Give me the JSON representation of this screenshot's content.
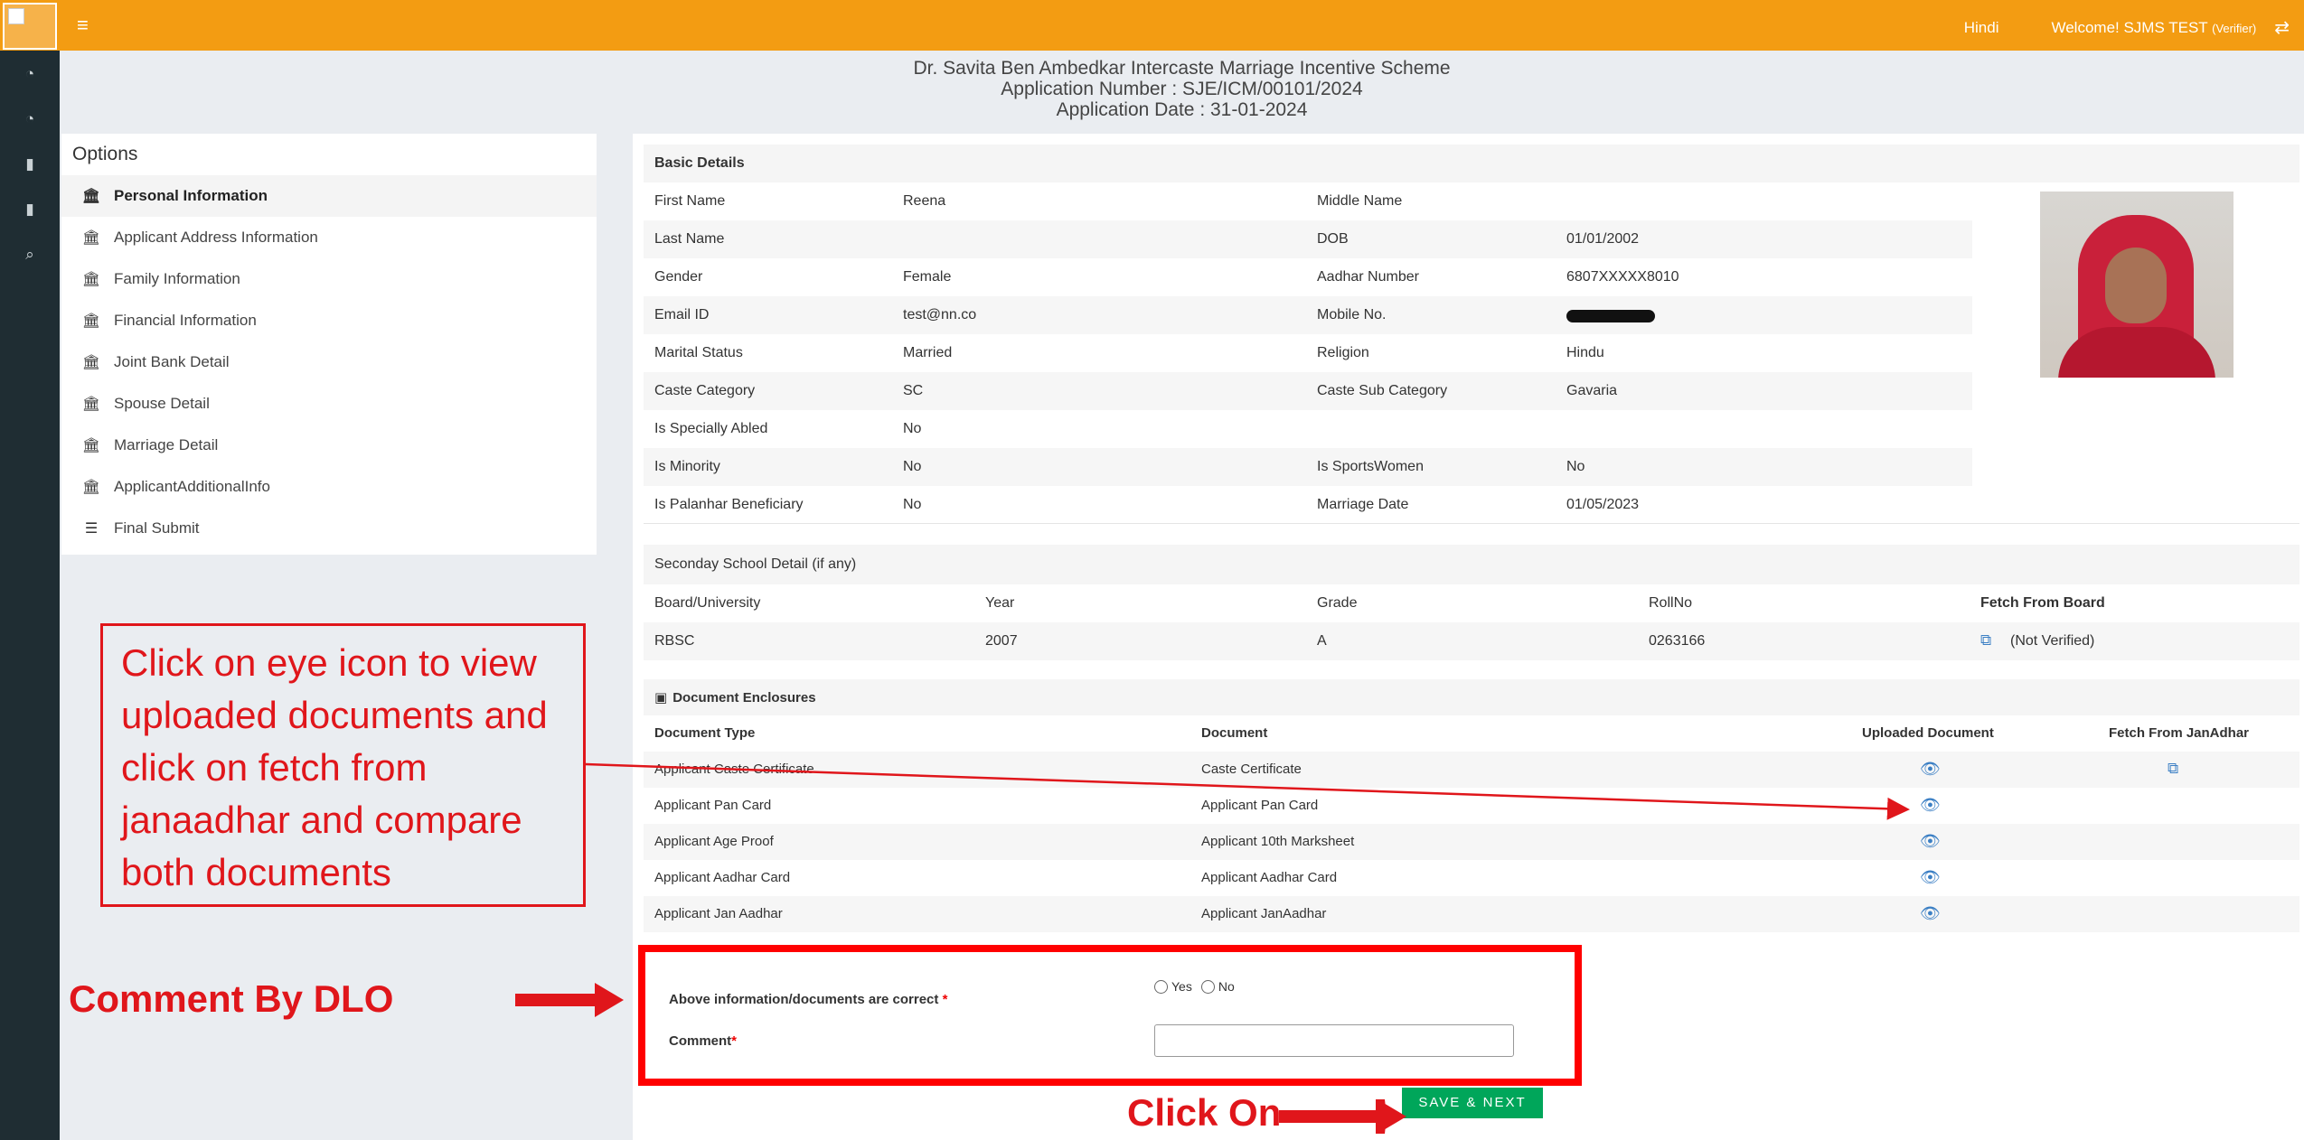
{
  "topbar": {
    "language": "Hindi",
    "welcome_prefix": "Welcome! SJMS TEST",
    "welcome_role": "(Verifier)",
    "menu_icon": "hamburger-icon",
    "swap_icon": "swap-icon"
  },
  "rail": {
    "icons": [
      "dashboard-icon",
      "dashboard-icon",
      "file-icon",
      "file-icon",
      "search-icon"
    ]
  },
  "header": {
    "scheme": "Dr. Savita Ben Ambedkar Intercaste Marriage Incentive Scheme",
    "app_number": "Application Number : SJE/ICM/00101/2024",
    "app_date": "Application Date : 31-01-2024"
  },
  "options": {
    "title": "Options",
    "items": [
      {
        "label": "Personal Information",
        "icon": "bank-icon",
        "active": true
      },
      {
        "label": "Applicant Address Information",
        "icon": "bank-icon"
      },
      {
        "label": "Family Information",
        "icon": "bank-icon"
      },
      {
        "label": "Financial Information",
        "icon": "bank-icon"
      },
      {
        "label": "Joint Bank Detail",
        "icon": "bank-icon"
      },
      {
        "label": "Spouse Detail",
        "icon": "bank-icon"
      },
      {
        "label": "Marriage Detail",
        "icon": "bank-icon"
      },
      {
        "label": "ApplicantAdditionalInfo",
        "icon": "bank-icon"
      },
      {
        "label": "Final Submit",
        "icon": "list-icon"
      }
    ]
  },
  "basic": {
    "title": "Basic Details",
    "rows": [
      {
        "l1": "First Name",
        "v1": "Reena",
        "l2": "Middle Name",
        "v2": ""
      },
      {
        "l1": "Last Name",
        "v1": "",
        "l2": "DOB",
        "v2": "01/01/2002"
      },
      {
        "l1": "Gender",
        "v1": "Female",
        "l2": "Aadhar Number",
        "v2": "6807XXXXX8010"
      },
      {
        "l1": "Email ID",
        "v1": "test@nn.co",
        "l2": "Mobile No.",
        "v2": ""
      },
      {
        "l1": "Marital Status",
        "v1": "Married",
        "l2": "Religion",
        "v2": "Hindu"
      },
      {
        "l1": "Caste Category",
        "v1": "SC",
        "l2": "Caste Sub Category",
        "v2": "Gavaria"
      },
      {
        "l1": "Is Specially Abled",
        "v1": "No",
        "l2": "",
        "v2": ""
      },
      {
        "l1": "Is Minority",
        "v1": "No",
        "l2": "Is SportsWomen",
        "v2": "No"
      },
      {
        "l1": "Is Palanhar Beneficiary",
        "v1": "No",
        "l2": "Marriage Date",
        "v2": "01/05/2023"
      }
    ]
  },
  "school": {
    "title": "Seconday School Detail (if any)",
    "headers": [
      "Board/University",
      "Year",
      "Grade",
      "RollNo",
      "Fetch From Board"
    ],
    "row": {
      "board": "RBSC",
      "year": "2007",
      "grade": "A",
      "roll": "0263166",
      "status": "(Not Verified)"
    }
  },
  "documents": {
    "title": "Document Enclosures",
    "headers": [
      "Document Type",
      "Document",
      "Uploaded Document",
      "Fetch From JanAdhar"
    ],
    "rows": [
      {
        "type": "Applicant Caste Certificate",
        "doc": "Caste Certificate",
        "fetch": true
      },
      {
        "type": "Applicant Pan Card",
        "doc": "Applicant Pan Card",
        "fetch": false
      },
      {
        "type": "Applicant Age Proof",
        "doc": "Applicant 10th Marksheet",
        "fetch": false
      },
      {
        "type": "Applicant Aadhar Card",
        "doc": "Applicant Aadhar Card",
        "fetch": false
      },
      {
        "type": "Applicant Jan Aadhar",
        "doc": "Applicant JanAadhar",
        "fetch": false
      }
    ]
  },
  "comment": {
    "question": "Above information/documents are correct",
    "required_mark": "*",
    "yes": "Yes",
    "no": "No",
    "comment_label": "Comment",
    "comment_value": ""
  },
  "save_label": "SAVE & NEXT",
  "annotations": {
    "note": "Click on eye icon to view uploaded documents and click on fetch from janaadhar and compare both documents",
    "dlo": "Comment By DLO",
    "click_on": "Click On",
    "color": "#e0161b"
  },
  "colors": {
    "topbar": "#f39c12",
    "rail": "#1f2d33",
    "save": "#00a65a",
    "link": "#3b7fc4"
  }
}
